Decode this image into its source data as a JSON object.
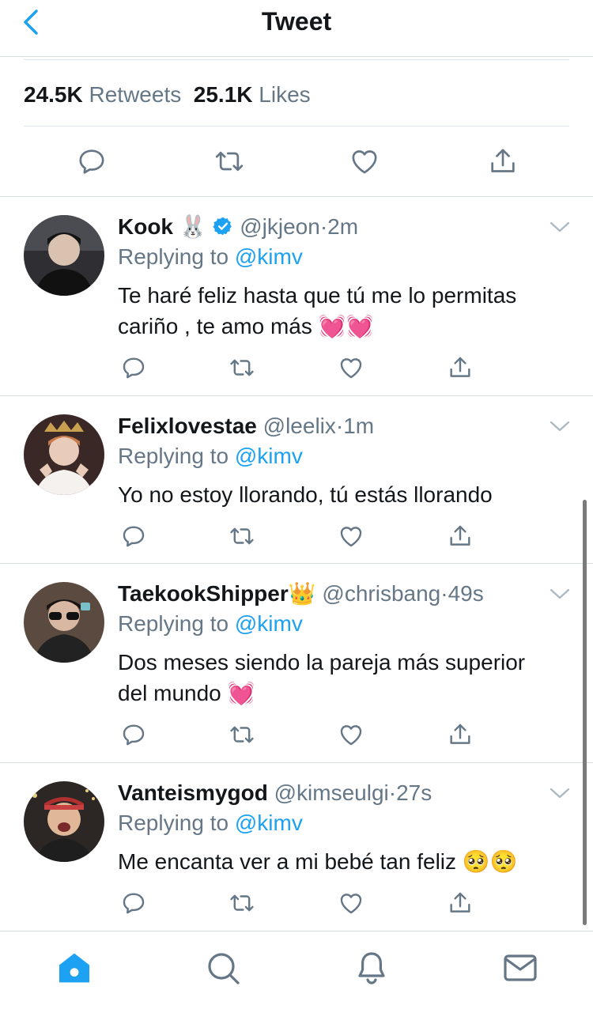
{
  "header": {
    "title": "Tweet",
    "back_icon": "chevron-left-icon"
  },
  "stats": {
    "retweets_count": "24.5K",
    "retweets_label": "Retweets",
    "likes_count": "25.1K",
    "likes_label": "Likes"
  },
  "colors": {
    "accent": "#1da1f2",
    "secondary_text": "#657786",
    "primary_text": "#14171a",
    "heart_emoji": "#f04fa0",
    "badge": "#1da1f2"
  },
  "replies": [
    {
      "name": "Kook",
      "name_emoji": "🐰",
      "verified": true,
      "handle": "@jkjeon",
      "dot": "·",
      "time": "2m",
      "replying_prefix": "Replying to",
      "replying_to": "@kimv",
      "text_line1": "Te haré feliz hasta que tú me lo permitas",
      "text_line2": "cariño , te amo más",
      "text_emoji": "💓💓"
    },
    {
      "name": "Felixlovestae",
      "handle": "@leelix",
      "dot": "·",
      "time": "1m",
      "replying_prefix": "Replying to",
      "replying_to": "@kimv",
      "text_line1": "Yo no estoy llorando, tú estás llorando"
    },
    {
      "name": "TaekookShipper",
      "name_emoji": "👑",
      "handle": "@chrisbang",
      "dot": "·",
      "time": "49s",
      "replying_prefix": "Replying to",
      "replying_to": "@kimv",
      "text_line1": "Dos meses siendo la pareja más superior",
      "text_line2": "del mundo",
      "text_emoji": "💓"
    },
    {
      "name": "Vanteismygod",
      "handle": "@kimseulgi",
      "dot": "·",
      "time": "27s",
      "replying_prefix": "Replying to",
      "replying_to": "@kimv",
      "text_line1": "Me encanta ver a mi bebé tan feliz",
      "text_emoji": "🥺🥺"
    }
  ],
  "tabbar": [
    "home-icon",
    "search-icon",
    "notifications-icon",
    "messages-icon"
  ]
}
